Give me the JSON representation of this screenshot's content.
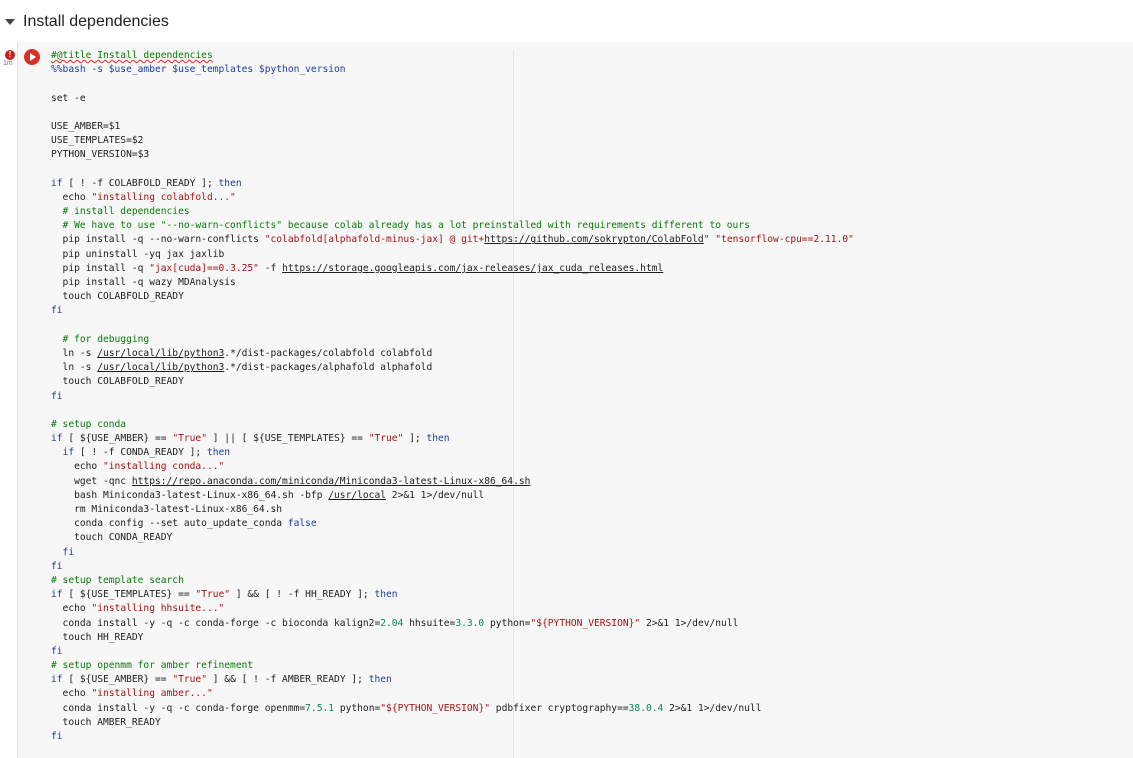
{
  "section": {
    "title": "Install dependencies"
  },
  "cell": {
    "exec_time": "1m",
    "error_badge": "!",
    "status_color": "#d93025",
    "code_lines": [
      [
        {
          "t": "#@title Install dependencies",
          "c": "comment"
        }
      ],
      [
        {
          "t": "%%bash -s $use_amber $use_templates $python_version",
          "c": "magic"
        }
      ],
      [],
      [
        {
          "t": "set -e",
          "c": ""
        }
      ],
      [],
      [
        {
          "t": "USE_AMBER=$1",
          "c": ""
        }
      ],
      [
        {
          "t": "USE_TEMPLATES=$2",
          "c": ""
        }
      ],
      [
        {
          "t": "PYTHON_VERSION=$3",
          "c": ""
        }
      ],
      [],
      [
        {
          "t": "if",
          "c": "keyword"
        },
        {
          "t": " [ ! -f COLABFOLD_READY ]; ",
          "c": ""
        },
        {
          "t": "then",
          "c": "keyword"
        }
      ],
      [
        {
          "t": "  echo ",
          "c": ""
        },
        {
          "t": "\"installing colabfold...\"",
          "c": "string"
        }
      ],
      [
        {
          "t": "  # install dependencies",
          "c": "comment"
        }
      ],
      [
        {
          "t": "  # We have to use \"--no-warn-conflicts\" because colab already has a lot preinstalled with requirements different to ours",
          "c": "comment"
        }
      ],
      [
        {
          "t": "  pip install -q --no-warn-conflicts ",
          "c": ""
        },
        {
          "t": "\"colabfold[alphafold-minus-jax] @ git+",
          "c": "string"
        },
        {
          "t": "https://github.com/sokrypton/ColabFold",
          "c": "url"
        },
        {
          "t": "\"",
          "c": "string"
        },
        {
          "t": " ",
          "c": ""
        },
        {
          "t": "\"tensorflow-cpu==2.11.0\"",
          "c": "string"
        }
      ],
      [
        {
          "t": "  pip uninstall -yq jax jaxlib",
          "c": ""
        }
      ],
      [
        {
          "t": "  pip install -q ",
          "c": ""
        },
        {
          "t": "\"jax[cuda]==0.3.25\"",
          "c": "string"
        },
        {
          "t": " -f ",
          "c": ""
        },
        {
          "t": "https://storage.googleapis.com/jax-releases/jax_cuda_releases.html",
          "c": "url"
        }
      ],
      [
        {
          "t": "  pip install -q wazy MDAnalysis",
          "c": ""
        }
      ],
      [
        {
          "t": "  touch COLABFOLD_READY",
          "c": ""
        }
      ],
      [
        {
          "t": "fi",
          "c": "keyword"
        }
      ],
      [],
      [
        {
          "t": "  # for debugging",
          "c": "comment"
        }
      ],
      [
        {
          "t": "  ln -s ",
          "c": ""
        },
        {
          "t": "/usr/local/lib/python3",
          "c": "url"
        },
        {
          "t": ".*/dist-packages/colabfold colabfold",
          "c": ""
        }
      ],
      [
        {
          "t": "  ln -s ",
          "c": ""
        },
        {
          "t": "/usr/local/lib/python3",
          "c": "url"
        },
        {
          "t": ".*/dist-packages/alphafold alphafold",
          "c": ""
        }
      ],
      [
        {
          "t": "  touch COLABFOLD_READY",
          "c": ""
        }
      ],
      [
        {
          "t": "fi",
          "c": "keyword"
        }
      ],
      [],
      [
        {
          "t": "# setup conda",
          "c": "comment"
        }
      ],
      [
        {
          "t": "if",
          "c": "keyword"
        },
        {
          "t": " [ ${USE_AMBER} == ",
          "c": ""
        },
        {
          "t": "\"True\"",
          "c": "string"
        },
        {
          "t": " ] || [ ${USE_TEMPLATES} == ",
          "c": ""
        },
        {
          "t": "\"True\"",
          "c": "string"
        },
        {
          "t": " ]; ",
          "c": ""
        },
        {
          "t": "then",
          "c": "keyword"
        }
      ],
      [
        {
          "t": "  ",
          "c": ""
        },
        {
          "t": "if",
          "c": "keyword"
        },
        {
          "t": " [ ! -f CONDA_READY ]; ",
          "c": ""
        },
        {
          "t": "then",
          "c": "keyword"
        }
      ],
      [
        {
          "t": "    echo ",
          "c": ""
        },
        {
          "t": "\"installing conda...\"",
          "c": "string"
        }
      ],
      [
        {
          "t": "    wget -qnc ",
          "c": ""
        },
        {
          "t": "https://repo.anaconda.com/miniconda/Miniconda3-latest-Linux-x86_64.sh",
          "c": "url"
        }
      ],
      [
        {
          "t": "    bash Miniconda3-latest-Linux-x86_64.sh -bfp ",
          "c": ""
        },
        {
          "t": "/usr/local",
          "c": "url"
        },
        {
          "t": " 2>&1 1>/dev/null",
          "c": ""
        }
      ],
      [
        {
          "t": "    rm Miniconda3-latest-Linux-x86_64.sh",
          "c": ""
        }
      ],
      [
        {
          "t": "    conda config --set auto_update_conda ",
          "c": ""
        },
        {
          "t": "false",
          "c": "keyword"
        }
      ],
      [
        {
          "t": "    touch CONDA_READY",
          "c": ""
        }
      ],
      [
        {
          "t": "  fi",
          "c": "keyword"
        }
      ],
      [
        {
          "t": "fi",
          "c": "keyword"
        }
      ],
      [
        {
          "t": "# setup template search",
          "c": "comment"
        }
      ],
      [
        {
          "t": "if",
          "c": "keyword"
        },
        {
          "t": " [ ${USE_TEMPLATES} == ",
          "c": ""
        },
        {
          "t": "\"True\"",
          "c": "string"
        },
        {
          "t": " ] && [ ! -f HH_READY ]; ",
          "c": ""
        },
        {
          "t": "then",
          "c": "keyword"
        }
      ],
      [
        {
          "t": "  echo ",
          "c": ""
        },
        {
          "t": "\"installing hhsuite...\"",
          "c": "string"
        }
      ],
      [
        {
          "t": "  conda install -y -q -c conda-forge -c bioconda kalign2=",
          "c": ""
        },
        {
          "t": "2.04",
          "c": "number"
        },
        {
          "t": " hhsuite=",
          "c": ""
        },
        {
          "t": "3.3.0",
          "c": "number"
        },
        {
          "t": " python=",
          "c": ""
        },
        {
          "t": "\"${PYTHON_VERSION}\"",
          "c": "string"
        },
        {
          "t": " 2>&1 1>/dev/null",
          "c": ""
        }
      ],
      [
        {
          "t": "  touch HH_READY",
          "c": ""
        }
      ],
      [
        {
          "t": "fi",
          "c": "keyword"
        }
      ],
      [
        {
          "t": "# setup openmm for amber refinement",
          "c": "comment"
        }
      ],
      [
        {
          "t": "if",
          "c": "keyword"
        },
        {
          "t": " [ ${USE_AMBER} == ",
          "c": ""
        },
        {
          "t": "\"True\"",
          "c": "string"
        },
        {
          "t": " ] && [ ! -f AMBER_READY ]; ",
          "c": ""
        },
        {
          "t": "then",
          "c": "keyword"
        }
      ],
      [
        {
          "t": "  echo ",
          "c": ""
        },
        {
          "t": "\"installing amber...\"",
          "c": "string"
        }
      ],
      [
        {
          "t": "  conda install -y -q -c conda-forge openmm=",
          "c": ""
        },
        {
          "t": "7.5.1",
          "c": "number"
        },
        {
          "t": " python=",
          "c": ""
        },
        {
          "t": "\"${PYTHON_VERSION}\"",
          "c": "string"
        },
        {
          "t": " pdbfixer cryptography==",
          "c": ""
        },
        {
          "t": "38.0.4",
          "c": "number"
        },
        {
          "t": " 2>&1 1>/dev/null",
          "c": ""
        }
      ],
      [
        {
          "t": "  touch AMBER_READY",
          "c": ""
        }
      ],
      [
        {
          "t": "fi",
          "c": "keyword"
        }
      ]
    ]
  }
}
